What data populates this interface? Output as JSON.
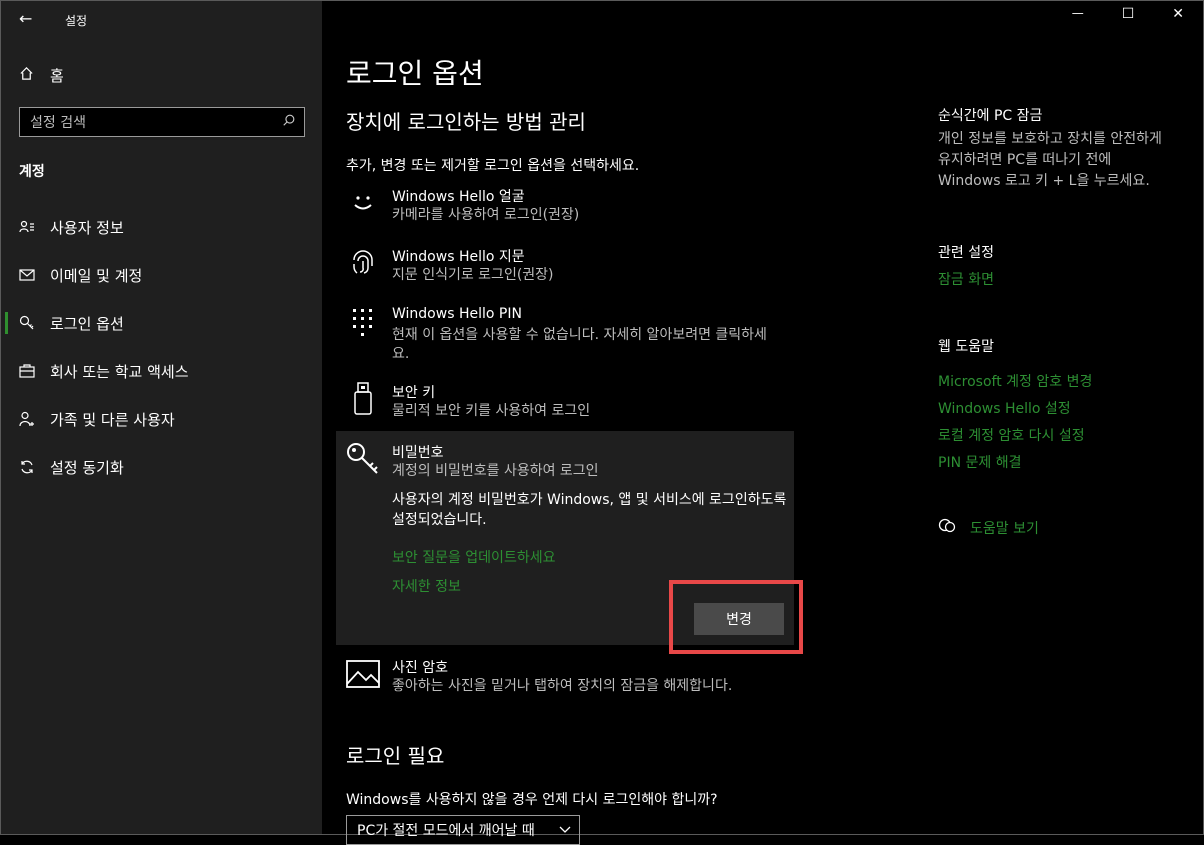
{
  "window": {
    "app_title": "설정",
    "back_glyph": "←",
    "minimize_glyph": "—",
    "maximize_glyph": "☐",
    "close_glyph": "✕"
  },
  "sidebar": {
    "home_label": "홈",
    "search_placeholder": "설정 검색",
    "section": "계정",
    "items": [
      {
        "label": "사용자 정보",
        "icon": "person-card-icon",
        "active": false
      },
      {
        "label": "이메일 및 계정",
        "icon": "mail-icon",
        "active": false
      },
      {
        "label": "로그인 옵션",
        "icon": "key-icon",
        "active": true
      },
      {
        "label": "회사 또는 학교 액세스",
        "icon": "briefcase-icon",
        "active": false
      },
      {
        "label": "가족 및 다른 사용자",
        "icon": "person-add-icon",
        "active": false
      },
      {
        "label": "설정 동기화",
        "icon": "sync-icon",
        "active": false
      }
    ]
  },
  "main": {
    "title": "로그인 옵션",
    "subtitle": "장치에 로그인하는 방법 관리",
    "description": "추가, 변경 또는 제거할 로그인 옵션을 선택하세요.",
    "options": [
      {
        "title": "Windows Hello 얼굴",
        "subtitle": "카메라를 사용하여 로그인(권장)",
        "icon": "face-icon"
      },
      {
        "title": "Windows Hello 지문",
        "subtitle": "지문 인식기로 로그인(권장)",
        "icon": "fingerprint-icon"
      },
      {
        "title": "Windows Hello PIN",
        "subtitle": "현재 이 옵션을 사용할 수 없습니다. 자세히 알아보려면 클릭하세요.",
        "icon": "pin-keypad-icon"
      },
      {
        "title": "보안 키",
        "subtitle": "물리적 보안 키를 사용하여 로그인",
        "icon": "usb-key-icon"
      }
    ],
    "password": {
      "title": "비밀번호",
      "subtitle": "계정의 비밀번호를 사용하여 로그인",
      "body": "사용자의 계정 비밀번호가 Windows, 앱 및 서비스에 로그인하도록 설정되었습니다.",
      "link_update": "보안 질문을 업데이트하세요",
      "link_more": "자세한 정보",
      "change_button": "변경"
    },
    "picture_password": {
      "title": "사진 암호",
      "subtitle": "좋아하는 사진을 밑거나 탭하여 장치의 잠금을 해제합니다."
    },
    "login_required": {
      "heading": "로그인 필요",
      "question": "Windows를 사용하지 않을 경우 언제 다시 로그인해야 합니까?",
      "dropdown_value": "PC가 절전 모드에서 깨어날 때"
    }
  },
  "right": {
    "lock_title": "순식간에 PC 잠금",
    "lock_text": "개인 정보를 보호하고 장치를 안전하게 유지하려면 PC를 떠나기 전에 Windows 로고 키 + L을 누르세요.",
    "related_title": "관련 설정",
    "related_link": "잠금 화면",
    "help_title": "웹 도움말",
    "help_links": [
      "Microsoft 계정 암호 변경",
      "Windows Hello 설정",
      "로컬 계정 암호 다시 설정",
      "PIN 문제 해결"
    ],
    "get_help": "도움말 보기"
  },
  "colors": {
    "accent_link": "#2d8f33",
    "highlight": "#e84848"
  }
}
